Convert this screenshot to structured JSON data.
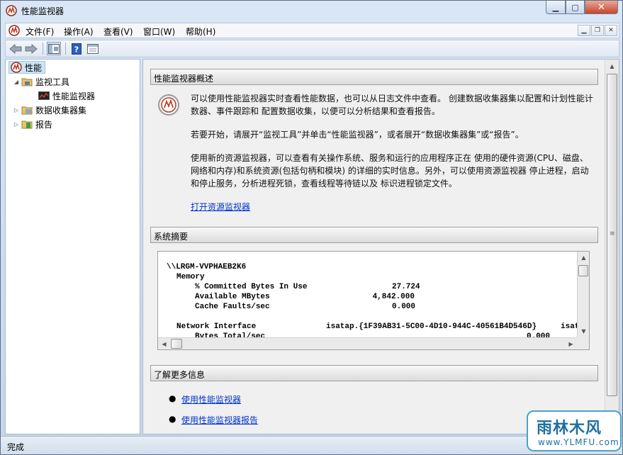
{
  "window": {
    "title": "性能监视器"
  },
  "menubar": {
    "items": [
      "文件(F)",
      "操作(A)",
      "查看(V)",
      "窗口(W)",
      "帮助(H)"
    ]
  },
  "tree": {
    "items": [
      {
        "label": "性能",
        "icon": "performance-icon"
      },
      {
        "label": "监视工具",
        "icon": "folder-icon"
      },
      {
        "label": "性能监视器",
        "icon": "monitor-chart-icon"
      },
      {
        "label": "数据收集器集",
        "icon": "data-collector-icon"
      },
      {
        "label": "报告",
        "icon": "report-icon"
      }
    ]
  },
  "overview": {
    "header": "性能监视器概述",
    "p1": "可以使用性能监视器实时查看性能数据，也可以从日志文件中查看。 创建数据收集器集以配置和计划性能计数器、事件跟踪和 配置数据收集，以便可以分析结果和查看报告。",
    "p2": "若要开始，请展开“监视工具”并单击“性能监视器”，或者展开“数据收集器集”或“报告”。",
    "p3": "使用新的资源监视器，可以查看有关操作系统、服务和运行的应用程序正在 使用的硬件资源(CPU、磁盘、网络和内存)和系统资源(包括句柄和模块) 的详细的实时信息。另外，可以使用资源监视器 停止进程，启动和停止服务，分析进程死锁，查看线程等待链以及 标识进程锁定文件。",
    "link": "打开资源监视器"
  },
  "summary": {
    "header": "系统摘要",
    "machine": "\\\\LRGM-VVPHAEB2K6",
    "memory_label": "Memory",
    "counters": [
      {
        "name": "% Committed Bytes In Use",
        "value": "27.724"
      },
      {
        "name": "Available MBytes",
        "value": "4,842.000"
      },
      {
        "name": "Cache Faults/sec",
        "value": "0.000"
      }
    ],
    "network_label": "Network Interface",
    "network_instance": "isatap.{1F39AB31-5C00-4D10-944C-40561B4D546D}",
    "network_instance2": "isat",
    "partial_counter": "Bytes Total/sec",
    "partial_value": "0.000"
  },
  "more": {
    "header": "了解更多信息",
    "links": [
      "使用性能监视器",
      "使用性能监视器报告"
    ]
  },
  "status": {
    "text": "完成"
  },
  "watermark": {
    "line1": "雨林木风",
    "line2": "www.YLMFU.com"
  }
}
